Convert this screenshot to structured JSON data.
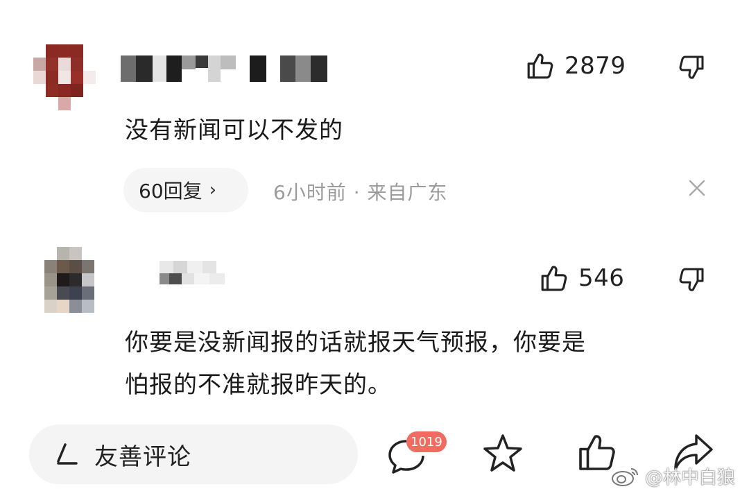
{
  "comments": [
    {
      "likes": "2879",
      "text": "没有新闻可以不发的",
      "replies_label": "60回复",
      "meta": "6小时前 · 来自广东"
    },
    {
      "likes": "546",
      "text_line1": "你要是没新闻报的话就报天气预报，你要是",
      "text_line2": "怕报的不准就报昨天的。"
    }
  ],
  "bottom_bar": {
    "input_placeholder": "友善评论",
    "comment_count": "1019"
  },
  "watermark": {
    "text": "@林中白狼"
  },
  "colors": {
    "badge": "#f06b60",
    "meta_text": "#9b9b9b",
    "pill_bg": "#f5f5f5"
  },
  "icons": [
    "thumbs-up-icon",
    "thumbs-down-icon",
    "chevron-right-icon",
    "close-icon",
    "pencil-icon",
    "comment-bubble-icon",
    "star-icon",
    "share-icon",
    "weibo-icon"
  ]
}
